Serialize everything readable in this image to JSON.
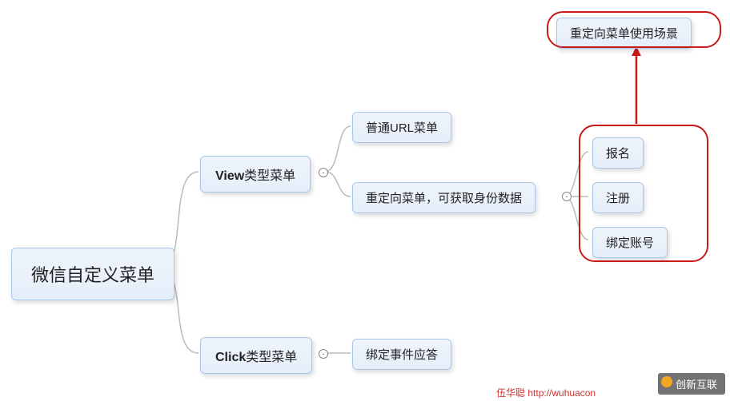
{
  "root": {
    "label": "微信自定义菜单"
  },
  "level2": {
    "view": {
      "label_prefix": "View",
      "label_suffix": "类型菜单"
    },
    "click": {
      "label_prefix": "Click",
      "label_suffix": "类型菜单"
    }
  },
  "level3": {
    "normal_url": "普通URL菜单",
    "redirect": "重定向菜单，可获取身份数据",
    "bind_event": "绑定事件应答"
  },
  "scenarios": {
    "title": "重定向菜单使用场景",
    "items": [
      "报名",
      "注册",
      "绑定账号"
    ]
  },
  "footer": {
    "author": "伍华聪",
    "url_prefix": "http://wuhuacon",
    "watermark": "创新互联"
  },
  "chart_data": {
    "type": "tree",
    "title": "微信自定义菜单",
    "nodes": [
      {
        "id": "root",
        "label": "微信自定义菜单",
        "parent": null
      },
      {
        "id": "view",
        "label": "View类型菜单",
        "parent": "root"
      },
      {
        "id": "click",
        "label": "Click类型菜单",
        "parent": "root"
      },
      {
        "id": "normal_url",
        "label": "普通URL菜单",
        "parent": "view"
      },
      {
        "id": "redirect",
        "label": "重定向菜单，可获取身份数据",
        "parent": "view"
      },
      {
        "id": "bind_event",
        "label": "绑定事件应答",
        "parent": "click"
      },
      {
        "id": "scenario_title",
        "label": "重定向菜单使用场景",
        "parent": "redirect",
        "annotation": true
      },
      {
        "id": "s1",
        "label": "报名",
        "parent": "redirect"
      },
      {
        "id": "s2",
        "label": "注册",
        "parent": "redirect"
      },
      {
        "id": "s3",
        "label": "绑定账号",
        "parent": "redirect"
      }
    ]
  }
}
